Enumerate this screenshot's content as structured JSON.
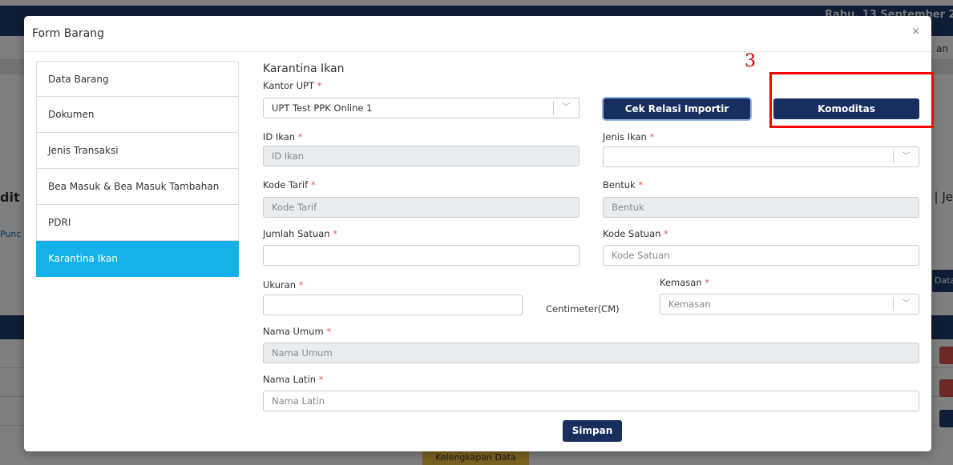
{
  "background": {
    "date": "Rabu, 13 September 202",
    "subbar_right": "an",
    "left_title": "dit",
    "left_link": "Punc",
    "right_text": "D | Je",
    "right_button": "Data",
    "footer_button": "Kelengkapan Data"
  },
  "modal": {
    "title": "Form Barang",
    "close_symbol": "×",
    "sidenav": [
      {
        "label": "Data Barang",
        "active": false
      },
      {
        "label": "Dokumen",
        "active": false
      },
      {
        "label": "Jenis Transaksi",
        "active": false
      },
      {
        "label": "Bea Masuk & Bea Masuk Tambahan",
        "active": false
      },
      {
        "label": "PDRI",
        "active": false
      },
      {
        "label": "Karantina Ikan",
        "active": true
      }
    ],
    "section_title": "Karantina Ikan",
    "form": {
      "kantor_upt": {
        "label": "Kantor UPT",
        "value": "UPT Test PPK Online 1"
      },
      "cek_relasi_button": "Cek Relasi Importir",
      "komoditas_button": "Komoditas",
      "id_ikan": {
        "label": "ID Ikan",
        "placeholder": "ID Ikan"
      },
      "jenis_ikan": {
        "label": "Jenis Ikan",
        "value": ""
      },
      "kode_tarif": {
        "label": "Kode Tarif",
        "placeholder": "Kode Tarif"
      },
      "bentuk": {
        "label": "Bentuk",
        "placeholder": "Bentuk"
      },
      "jumlah_satuan": {
        "label": "Jumlah Satuan",
        "value": ""
      },
      "kode_satuan": {
        "label": "Kode Satuan",
        "placeholder": "Kode Satuan"
      },
      "ukuran": {
        "label": "Ukuran",
        "value": "",
        "unit": "Centimeter(CM)"
      },
      "kemasan": {
        "label": "Kemasan",
        "placeholder": "Kemasan"
      },
      "nama_umum": {
        "label": "Nama Umum",
        "placeholder": "Nama Umum"
      },
      "nama_latin": {
        "label": "Nama Latin",
        "placeholder": "Nama Latin"
      },
      "required_mark": "*",
      "save_button": "Simpan"
    }
  },
  "annotation": {
    "number": "3",
    "color": "#ff0000"
  },
  "colors": {
    "navy": "#172e5f",
    "active_tab": "#16b1e8"
  },
  "icons": {
    "dropdown": "chevron-down-icon",
    "close": "close-icon"
  }
}
